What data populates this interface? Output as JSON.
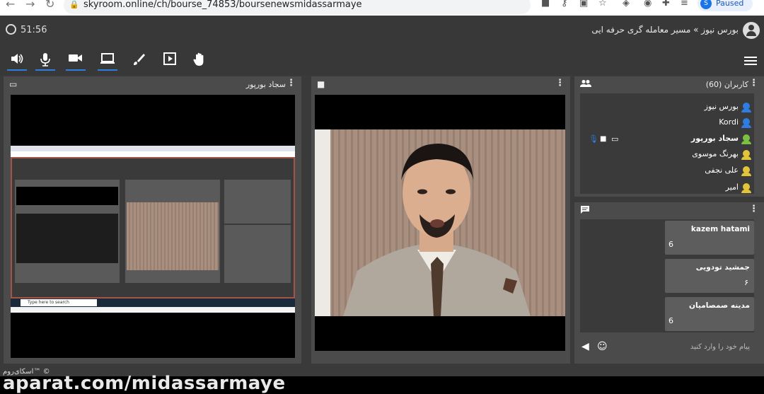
{
  "browser": {
    "url": "skyroom.online/ch/bourse_74853/boursenewsmidassarmaye",
    "profile_initial": "S",
    "profile_status": "Paused"
  },
  "header": {
    "timer": "51:56",
    "room_title": "بورس نیوز » مسیر معامله گری حرفه ایی"
  },
  "screenshare": {
    "title": "سجاد بورپور",
    "taskbar_search": "Type here to search"
  },
  "users": {
    "title": "کاربران (60)",
    "items": [
      {
        "name": "بورس نیوز",
        "color": "#2f7de1",
        "bold": false
      },
      {
        "name": "Kordi",
        "color": "#2f7de1",
        "bold": false
      },
      {
        "name": "سجاد بورپور",
        "color": "#7cc043",
        "bold": true
      },
      {
        "name": "بهرنگ موسوی",
        "color": "#e2c33a",
        "bold": false
      },
      {
        "name": "علی نجفی",
        "color": "#e2c33a",
        "bold": false
      },
      {
        "name": "امیر",
        "color": "#e2c33a",
        "bold": false
      }
    ]
  },
  "chat": {
    "messages": [
      {
        "name": "kazem hatami",
        "text": "6"
      },
      {
        "name": "جمشید تودویی",
        "text": "۶"
      },
      {
        "name": "مدینه صمصامیان",
        "text": "6"
      }
    ],
    "placeholder": "پیام خود را وارد کنید"
  },
  "footer": {
    "copyright": "اسکای‌روم™ ©",
    "watermark": "aparat.com/midassarmaye"
  },
  "colors": {
    "accent": "#2f7de1",
    "bg": "#383838",
    "panel": "#4b4b4b"
  }
}
